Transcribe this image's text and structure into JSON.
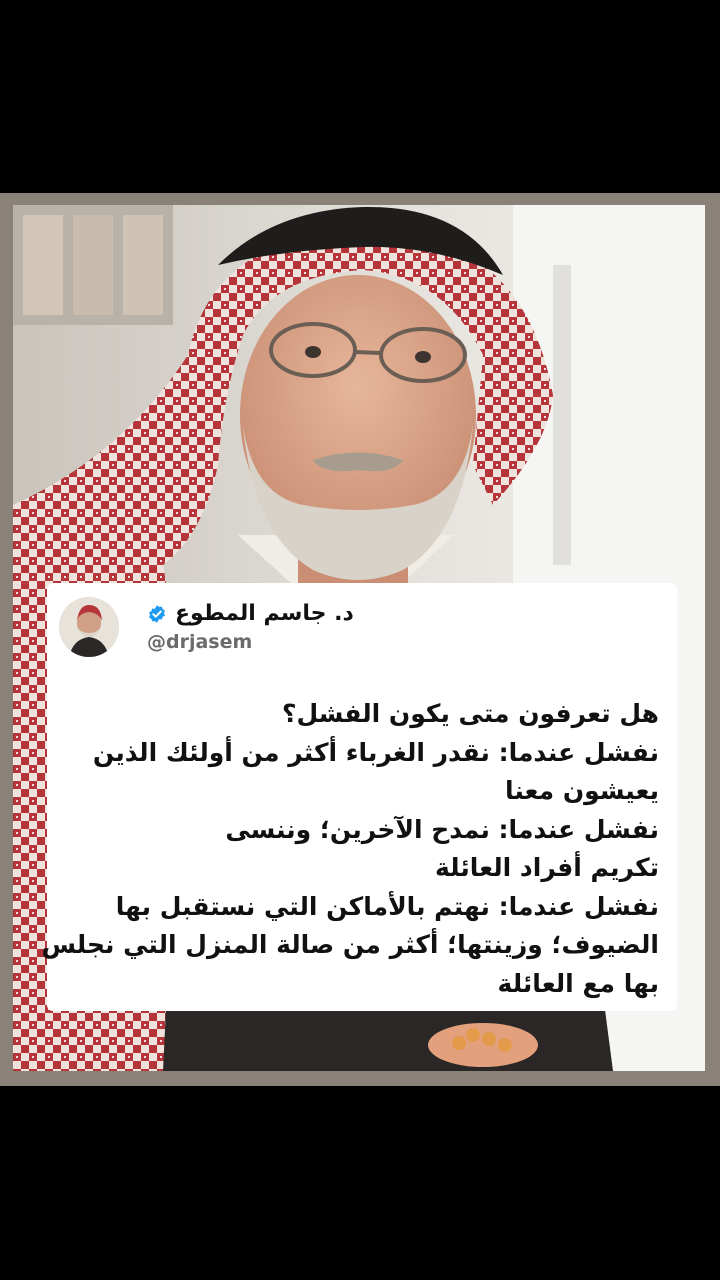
{
  "tweet": {
    "display_name": "د. جاسم المطوع",
    "handle": "@drjasem",
    "lines": [
      "هل تعرفون متى يكون الفشل؟",
      "نفشل عندما: نقدر الغرباء أكثر من أولئك الذين",
      "يعيشون معنا",
      "نفشل عندما:  نمدح الآخرين؛ وننسى",
      "تكريم أفراد العائلة",
      "نفشل عندما: نهتم بالأماكن التي نستقبل بها",
      "الضيوف؛ وزينتها؛ أكثر من صالة المنزل التي نجلس",
      "بها مع العائلة"
    ]
  },
  "icons": {
    "verified": "verified-badge-icon",
    "avatar": "profile-photo"
  },
  "colors": {
    "background": "#000000",
    "card": "#ffffff",
    "text": "#111111",
    "handle": "#6b6b6b",
    "verified": "#1d9bf0",
    "shemagh_red": "#b5363a"
  }
}
